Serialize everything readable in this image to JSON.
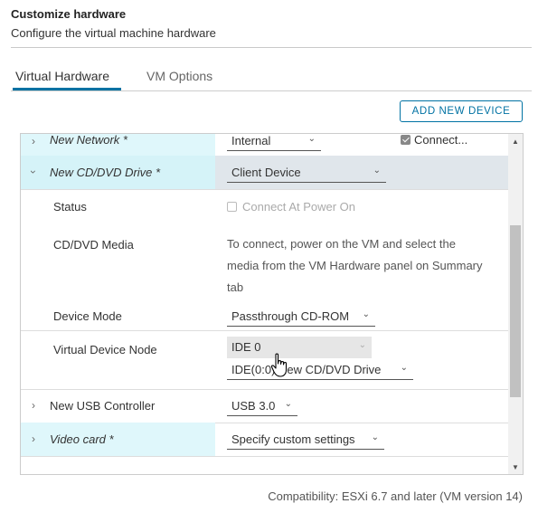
{
  "header": {
    "title": "Customize hardware",
    "subtitle": "Configure the virtual machine hardware"
  },
  "tabs": [
    {
      "label": "Virtual Hardware",
      "active": true
    },
    {
      "label": "VM Options",
      "active": false
    }
  ],
  "toolbar": {
    "add_device_label": "ADD NEW DEVICE"
  },
  "devices": {
    "network": {
      "label": "New Network *",
      "value": "Internal",
      "connect_label": "Connect...",
      "connect_checked": true
    },
    "cd": {
      "label": "New CD/DVD Drive *",
      "value": "Client Device",
      "status_label": "Status",
      "status_checkbox_label": "Connect At Power On",
      "media_label": "CD/DVD Media",
      "media_description": "To connect, power on the VM and select the media from the VM Hardware panel on Summary tab",
      "mode_label": "Device Mode",
      "mode_value": "Passthrough CD-ROM",
      "node_label": "Virtual Device Node",
      "node_controller": "IDE 0",
      "node_value": "IDE(0:0) New CD/DVD Drive"
    },
    "usb": {
      "label": "New USB Controller",
      "value": "USB 3.0"
    },
    "video": {
      "label": "Video card *",
      "value": "Specify custom settings"
    }
  },
  "footer": {
    "compatibility": "Compatibility: ESXi 6.7 and later (VM version 14)"
  },
  "colors": {
    "accent": "#0072a3",
    "row_highlight": "#dff7fb"
  }
}
